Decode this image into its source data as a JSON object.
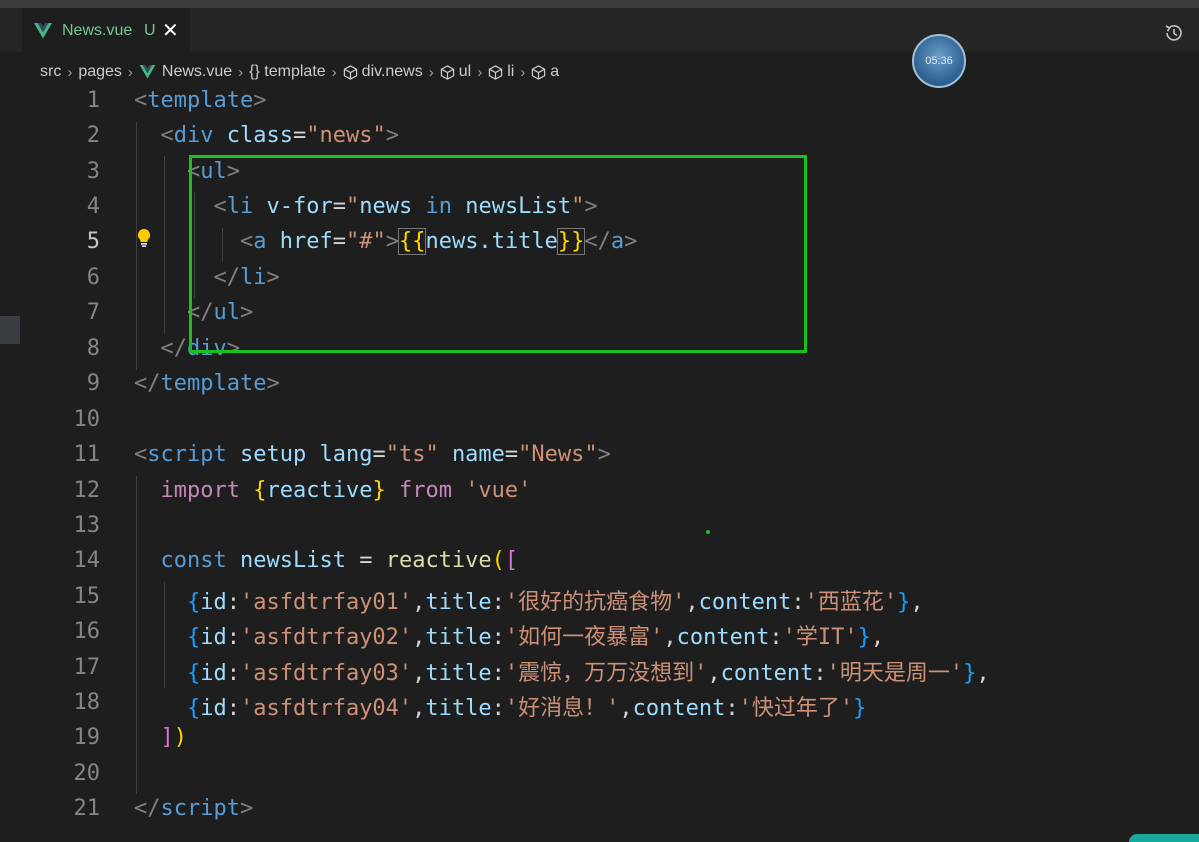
{
  "tab": {
    "file_name": "News.vue",
    "status": "U",
    "close_glyph": "✕"
  },
  "breadcrumb": [
    "src",
    "pages",
    "News.vue",
    "{} template",
    "div.news",
    "ul",
    "li",
    "a"
  ],
  "timer": "05:36",
  "icons": {
    "vue": "vue-logo-icon",
    "close": "close-icon",
    "history": "history-icon",
    "element": "cube-icon",
    "lightbulb": "lightbulb-icon"
  },
  "colors": {
    "highlight_box": "#19c11d",
    "modified": "#73c991"
  },
  "line_numbers": [
    "1",
    "2",
    "3",
    "4",
    "5",
    "6",
    "7",
    "8",
    "9",
    "10",
    "11",
    "12",
    "13",
    "14",
    "15",
    "16",
    "17",
    "18",
    "19",
    "20",
    "21"
  ],
  "active_line": "5",
  "code": {
    "l1": [
      "<",
      "template",
      ">"
    ],
    "l2": [
      "<",
      "div",
      " ",
      "class",
      "=",
      "\"news\"",
      ">"
    ],
    "l3": [
      "<",
      "ul",
      ">"
    ],
    "l4": [
      "<",
      "li",
      " ",
      "v-for",
      "=",
      "\"",
      "news",
      " ",
      "in",
      " ",
      "newsList",
      "\"",
      ">"
    ],
    "l5": [
      "<",
      "a",
      " ",
      "href",
      "=",
      "\"#\"",
      ">",
      "{{",
      "news.title",
      "}}",
      "</",
      "a",
      ">"
    ],
    "l6": [
      "</",
      "li",
      ">"
    ],
    "l7": [
      "</",
      "ul",
      ">"
    ],
    "l8": [
      "</",
      "div",
      ">"
    ],
    "l9": [
      "</",
      "template",
      ">"
    ],
    "l11": [
      "<",
      "script",
      " ",
      "setup",
      " ",
      "lang",
      "=",
      "\"ts\"",
      " ",
      "name",
      "=",
      "\"News\"",
      ">"
    ],
    "l12": [
      "import",
      " ",
      "{",
      "reactive",
      "}",
      " ",
      "from",
      " ",
      "'vue'"
    ],
    "l14": [
      "const",
      " ",
      "newsList",
      " ",
      "=",
      " ",
      "reactive",
      "(",
      "["
    ],
    "l15": [
      "{",
      "id",
      ":",
      "'asfdtrfay01'",
      ",",
      "title",
      ":",
      "'很好的抗癌食物'",
      ",",
      "content",
      ":",
      "'西蓝花'",
      "}",
      ","
    ],
    "l16": [
      "{",
      "id",
      ":",
      "'asfdtrfay02'",
      ",",
      "title",
      ":",
      "'如何一夜暴富'",
      ",",
      "content",
      ":",
      "'学IT'",
      "}",
      ","
    ],
    "l17": [
      "{",
      "id",
      ":",
      "'asfdtrfay03'",
      ",",
      "title",
      ":",
      "'震惊，万万没想到'",
      ",",
      "content",
      ":",
      "'明天是周一'",
      "}",
      ","
    ],
    "l18": [
      "{",
      "id",
      ":",
      "'asfdtrfay04'",
      ",",
      "title",
      ":",
      "'好消息！'",
      ",",
      "content",
      ":",
      "'快过年了'",
      "}"
    ],
    "l19": [
      "]",
      ")"
    ],
    "l21": [
      "</",
      "script",
      ">"
    ]
  }
}
